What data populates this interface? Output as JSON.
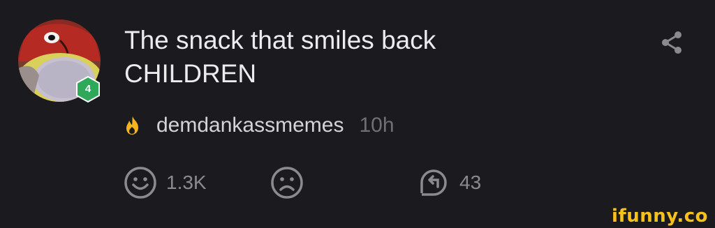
{
  "post": {
    "title_line1": "The snack that smiles back",
    "title_line2": "CHILDREN",
    "author": "demdankassmemes",
    "time": "10h",
    "author_level": "4",
    "author_badge_icon": "fire-icon"
  },
  "actions": {
    "smiles_count": "1.3K",
    "unsmile_icon": "sad-face-icon",
    "smile_icon": "smiley-face-icon",
    "repub_count": "43",
    "repub_icon": "repub-icon",
    "share_icon": "share-icon"
  },
  "watermark": "ifunny.co",
  "colors": {
    "background": "#1b1b1f",
    "level_badge": "#2fa85a",
    "fire": "#f4b51c",
    "watermark": "#f4c21b"
  }
}
